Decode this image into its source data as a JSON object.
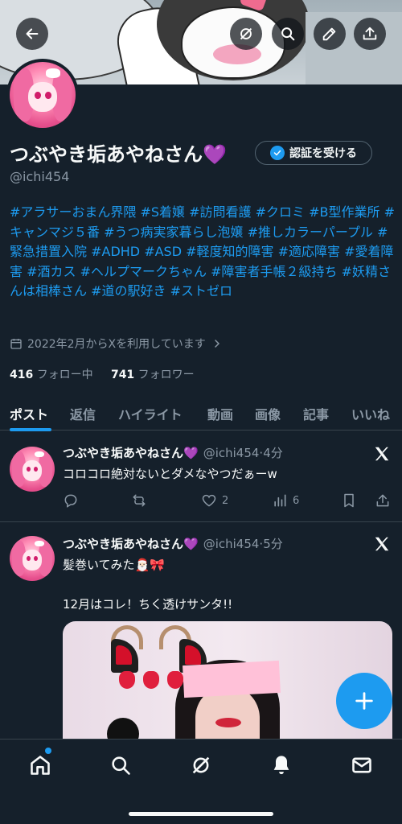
{
  "profile": {
    "display_name": "つぶやき垢あやねさん",
    "heart_emoji": "💜",
    "handle": "@ichi454",
    "certify_button": "認証を受ける",
    "bio": "#アラサーおまん界隈 #S着嬢 #訪問看護 #クロミ #B型作業所 #キャンマジ５番 #うつ病実家暮らし泡嬢 #推しカラーパープル #緊急措置入院 #ADHD #ASD #軽度知的障害 #適応障害 #愛着障害 #酒カス #ヘルプマークちゃん #障害者手帳２級持ち #妖精さんは相棒さん #道の駅好き #ストゼロ",
    "joined": "2022年2月からXを利用しています",
    "following_count": "416",
    "following_label": "フォロー中",
    "followers_count": "741",
    "followers_label": "フォロワー"
  },
  "tabs": [
    "ポスト",
    "返信",
    "ハイライト",
    "動画",
    "画像",
    "記事",
    "いいね"
  ],
  "posts": [
    {
      "name": "つぶやき垢あやねさん",
      "heart": "💜",
      "meta": "@ichi454·4分",
      "text": "コロコロ絶対ないとダメなやつだぁーw",
      "likes": "2",
      "views": "6"
    },
    {
      "name": "つぶやき垢あやねさん",
      "heart": "💜",
      "meta": "@ichi454·5分",
      "text": "髪巻いてみた🎅🏻🎀",
      "text2": "12月はコレ！ちく透けサンタ!!"
    }
  ],
  "icons": {
    "back": "arrow-left-icon",
    "grok": "grok-icon",
    "search": "search-icon",
    "edit": "pencil-icon",
    "share": "share-icon",
    "compose": "plus-icon"
  },
  "colors": {
    "background": "#15202b",
    "accent": "#1d9bf0",
    "muted": "#8b98a5",
    "heart": "#a855f7"
  }
}
